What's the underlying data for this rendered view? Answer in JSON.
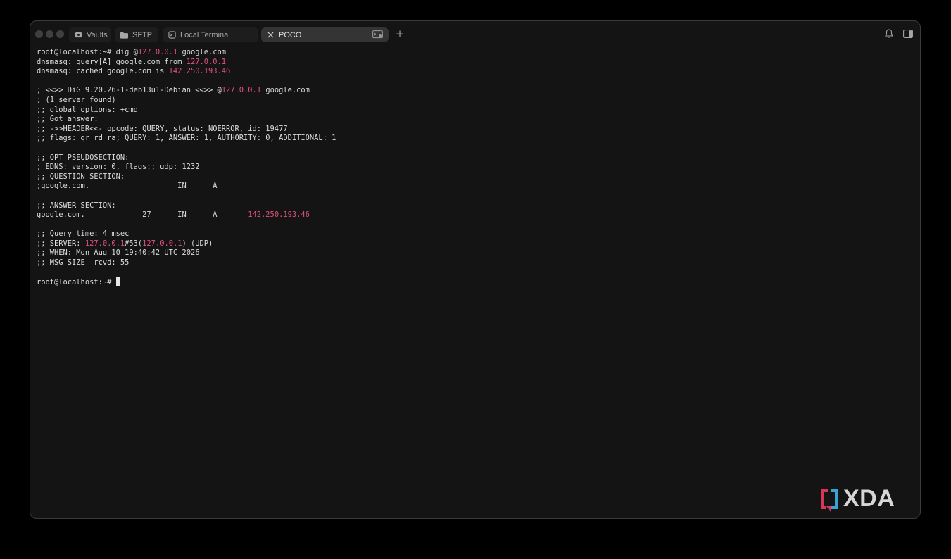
{
  "tabs": [
    {
      "label": "Vaults",
      "icon": "vault-icon",
      "active": false
    },
    {
      "label": "SFTP",
      "icon": "folder-icon",
      "active": false
    },
    {
      "label": "Local Terminal",
      "icon": "terminal-icon",
      "active": false
    },
    {
      "label": "POCO",
      "icon": "close-icon",
      "active": true
    }
  ],
  "toolbar": {
    "new_tab_icon": "plus-icon",
    "notification_icon": "bell-icon",
    "sidebar_icon": "sidebar-toggle-icon"
  },
  "colors": {
    "highlight": "#e0527a",
    "text": "#dcdcdc",
    "background": "#141414"
  },
  "terminal": {
    "lines": [
      {
        "segments": [
          {
            "t": "root@localhost:~# dig @"
          },
          {
            "t": "127.0.0.1",
            "hl": true
          },
          {
            "t": " google.com"
          }
        ]
      },
      {
        "segments": [
          {
            "t": "dnsmasq: query[A] google.com from "
          },
          {
            "t": "127.0.0.1",
            "hl": true
          }
        ]
      },
      {
        "segments": [
          {
            "t": "dnsmasq: cached google.com is "
          },
          {
            "t": "142.250.193.46",
            "hl": true
          }
        ]
      },
      {
        "segments": []
      },
      {
        "segments": [
          {
            "t": "; <<>> DiG 9.20.26-1-deb13u1-Debian <<>> @"
          },
          {
            "t": "127.0.0.1",
            "hl": true
          },
          {
            "t": " google.com"
          }
        ]
      },
      {
        "segments": [
          {
            "t": "; (1 server found)"
          }
        ]
      },
      {
        "segments": [
          {
            "t": ";; global options: +cmd"
          }
        ]
      },
      {
        "segments": [
          {
            "t": ";; Got answer:"
          }
        ]
      },
      {
        "segments": [
          {
            "t": ";; ->>HEADER<<- opcode: QUERY, status: NOERROR, id: 19477"
          }
        ]
      },
      {
        "segments": [
          {
            "t": ";; flags: qr rd ra; QUERY: 1, ANSWER: 1, AUTHORITY: 0, ADDITIONAL: 1"
          }
        ]
      },
      {
        "segments": []
      },
      {
        "segments": [
          {
            "t": ";; OPT PSEUDOSECTION:"
          }
        ]
      },
      {
        "segments": [
          {
            "t": "; EDNS: version: 0, flags:; udp: 1232"
          }
        ]
      },
      {
        "segments": [
          {
            "t": ";; QUESTION SECTION:"
          }
        ]
      },
      {
        "segments": [
          {
            "t": ";google.com.\t\t\tIN\tA"
          }
        ]
      },
      {
        "segments": []
      },
      {
        "segments": [
          {
            "t": ";; ANSWER SECTION:"
          }
        ]
      },
      {
        "segments": [
          {
            "t": "google.com.\t\t27\tIN\tA\t"
          },
          {
            "t": "142.250.193.46",
            "hl": true
          }
        ]
      },
      {
        "segments": []
      },
      {
        "segments": [
          {
            "t": ";; Query time: 4 msec"
          }
        ]
      },
      {
        "segments": [
          {
            "t": ";; SERVER: "
          },
          {
            "t": "127.0.0.1",
            "hl": true
          },
          {
            "t": "#53("
          },
          {
            "t": "127.0.0.1",
            "hl": true
          },
          {
            "t": ") (UDP)"
          }
        ]
      },
      {
        "segments": [
          {
            "t": ";; WHEN: Mon Aug 10 19:40:42 UTC 2026"
          }
        ]
      },
      {
        "segments": [
          {
            "t": ";; MSG SIZE  rcvd: 55"
          }
        ]
      },
      {
        "segments": []
      },
      {
        "segments": [
          {
            "t": "root@localhost:~# "
          }
        ],
        "cursor": true
      }
    ]
  },
  "watermark": {
    "text": "XDA"
  }
}
